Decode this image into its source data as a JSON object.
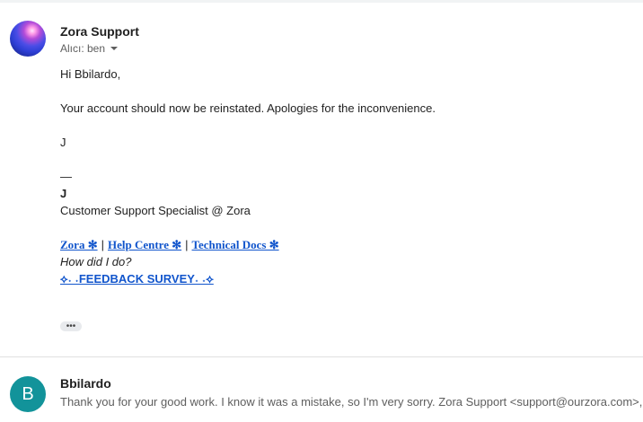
{
  "message1": {
    "sender": "Zora Support",
    "recipient_label": "Alıcı: ben",
    "body": {
      "greeting": "Hi Bbilardo,",
      "line1": "Your account should now be reinstated. Apologies for the inconvenience.",
      "initial": "J",
      "sig_dash": "—",
      "sig_name": "J",
      "sig_title": "Customer Support Specialist @ Zora",
      "links": [
        "Zora ✻",
        "Help Centre ✻",
        "Technical Docs ✻"
      ],
      "separator": "|",
      "feedback_prompt": "How did I do?",
      "survey_link": "⟡˖ ˖FEEDBACK SURVEY˖ ˖⟡"
    },
    "show_trimmed": "•••"
  },
  "message2": {
    "avatar_letter": "B",
    "sender": "Bbilardo",
    "snippet": "Thank you for your good work. I know it was a mistake, so I'm very sorry. Zora Support <support@ourzora.com>,"
  },
  "colors": {
    "link": "#1155cc",
    "avatar2": "#12939a",
    "meta_text": "#5e5e5e"
  }
}
